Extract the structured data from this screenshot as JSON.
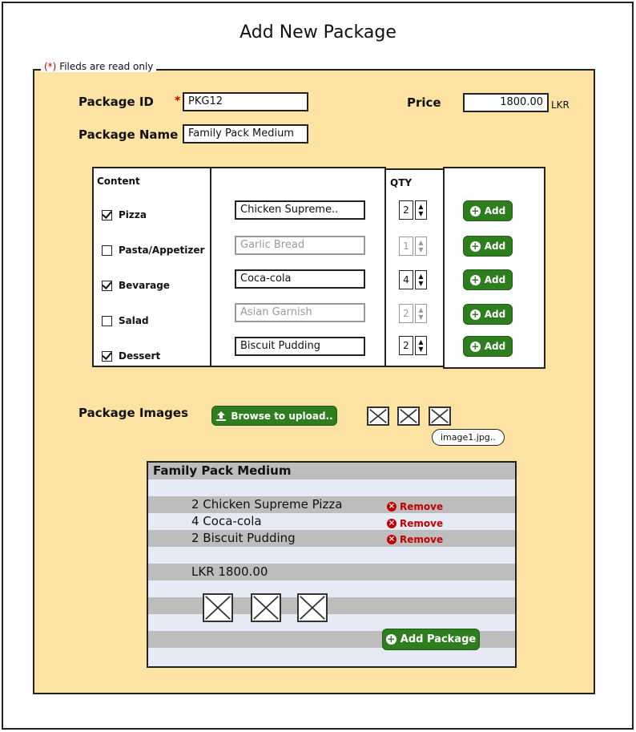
{
  "page": {
    "title": "Add New Package"
  },
  "legend": {
    "marker": "(*)",
    "text": " Fileds are read only"
  },
  "form": {
    "package_id_label": "Package ID",
    "package_id_value": "PKG12",
    "required_marker": "*",
    "price_label": "Price",
    "price_value": "1800.00",
    "price_unit": "LKR",
    "package_name_label": "Package Name",
    "package_name_value": "Family Pack Medium"
  },
  "content": {
    "header": "Content",
    "qty_header": "QTY",
    "rows": [
      {
        "category": "Pizza",
        "checked": true,
        "item": "Chicken Supreme..",
        "qty": "2",
        "enabled": true,
        "add_label": "Add"
      },
      {
        "category": "Pasta/Appetizer",
        "checked": false,
        "item": "Garlic Bread",
        "qty": "1",
        "enabled": false,
        "add_label": "Add"
      },
      {
        "category": "Bevarage",
        "checked": true,
        "item": "Coca-cola",
        "qty": "4",
        "enabled": true,
        "add_label": "Add"
      },
      {
        "category": "Salad",
        "checked": false,
        "item": "Asian Garnish",
        "qty": "2",
        "enabled": false,
        "add_label": "Add"
      },
      {
        "category": "Dessert",
        "checked": true,
        "item": "Biscuit Pudding",
        "qty": "2",
        "enabled": true,
        "add_label": "Add"
      }
    ]
  },
  "images": {
    "label": "Package Images",
    "upload_button": "Browse to upload..",
    "tooltip": "image1.jpg.."
  },
  "summary": {
    "title": "Family Pack Medium",
    "lines": [
      {
        "text": "2 Chicken Supreme Pizza",
        "remove": "Remove"
      },
      {
        "text": "4 Coca-cola",
        "remove": "Remove"
      },
      {
        "text": "2 Biscuit Pudding",
        "remove": "Remove"
      }
    ],
    "total": "LKR 1800.00",
    "add_button": "Add Package"
  },
  "colors": {
    "panel": "#fde3a3",
    "button_green": "#2e7d1f",
    "remove_red": "#c00000",
    "stripe_gray": "#bdbdbd",
    "stripe_blue": "#e5eaf4"
  },
  "icons": {
    "add": "plus-circle-icon",
    "remove": "x-circle-icon",
    "upload": "upload-icon",
    "stepper": "up-down-arrows-icon",
    "image": "image-placeholder-icon"
  }
}
